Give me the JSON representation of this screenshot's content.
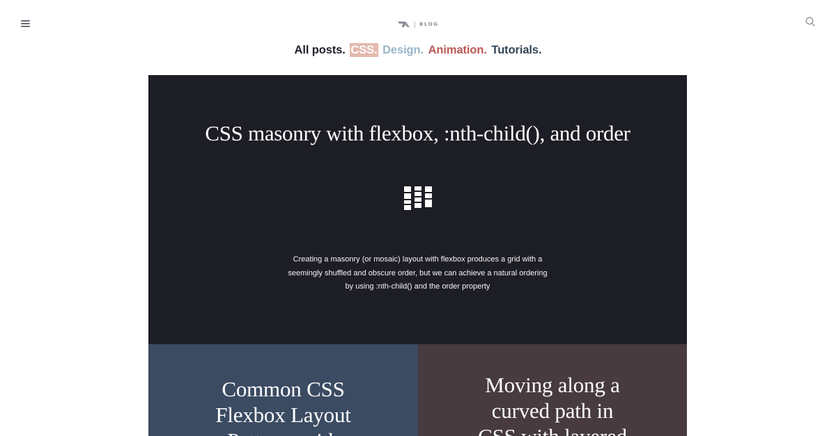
{
  "header": {
    "brand_label": "BLOG",
    "brand_logo_icon": "ta-logo-icon",
    "menu_icon": "hamburger-menu-icon",
    "search_icon": "search-icon"
  },
  "categories": {
    "all": "All posts.",
    "css": "CSS.",
    "design": "Design.",
    "animation": "Animation.",
    "tutorials": "Tutorials."
  },
  "colors": {
    "all": "#1f222c",
    "css_highlight": "#e3b9ad",
    "design": "#9ab6c8",
    "animation": "#b85a57",
    "tutorials": "#344556",
    "hero_bg": "#1d1e25",
    "card_left_bg": "#3b4b62",
    "card_right_bg": "#473b3f"
  },
  "hero": {
    "title": "CSS masonry with flexbox, :nth-child(), and order",
    "icon": "masonry-grid-icon",
    "excerpt": "Creating a masonry (or mosaic) layout with flexbox produces a grid with a seemingly shuffled and obscure order, but we can achieve a natural ordering by using :nth-child() and the order property"
  },
  "cards": [
    {
      "title": "Common CSS Flexbox Layout Patterns with"
    },
    {
      "title": "Moving along a curved path in CSS with layered"
    }
  ]
}
